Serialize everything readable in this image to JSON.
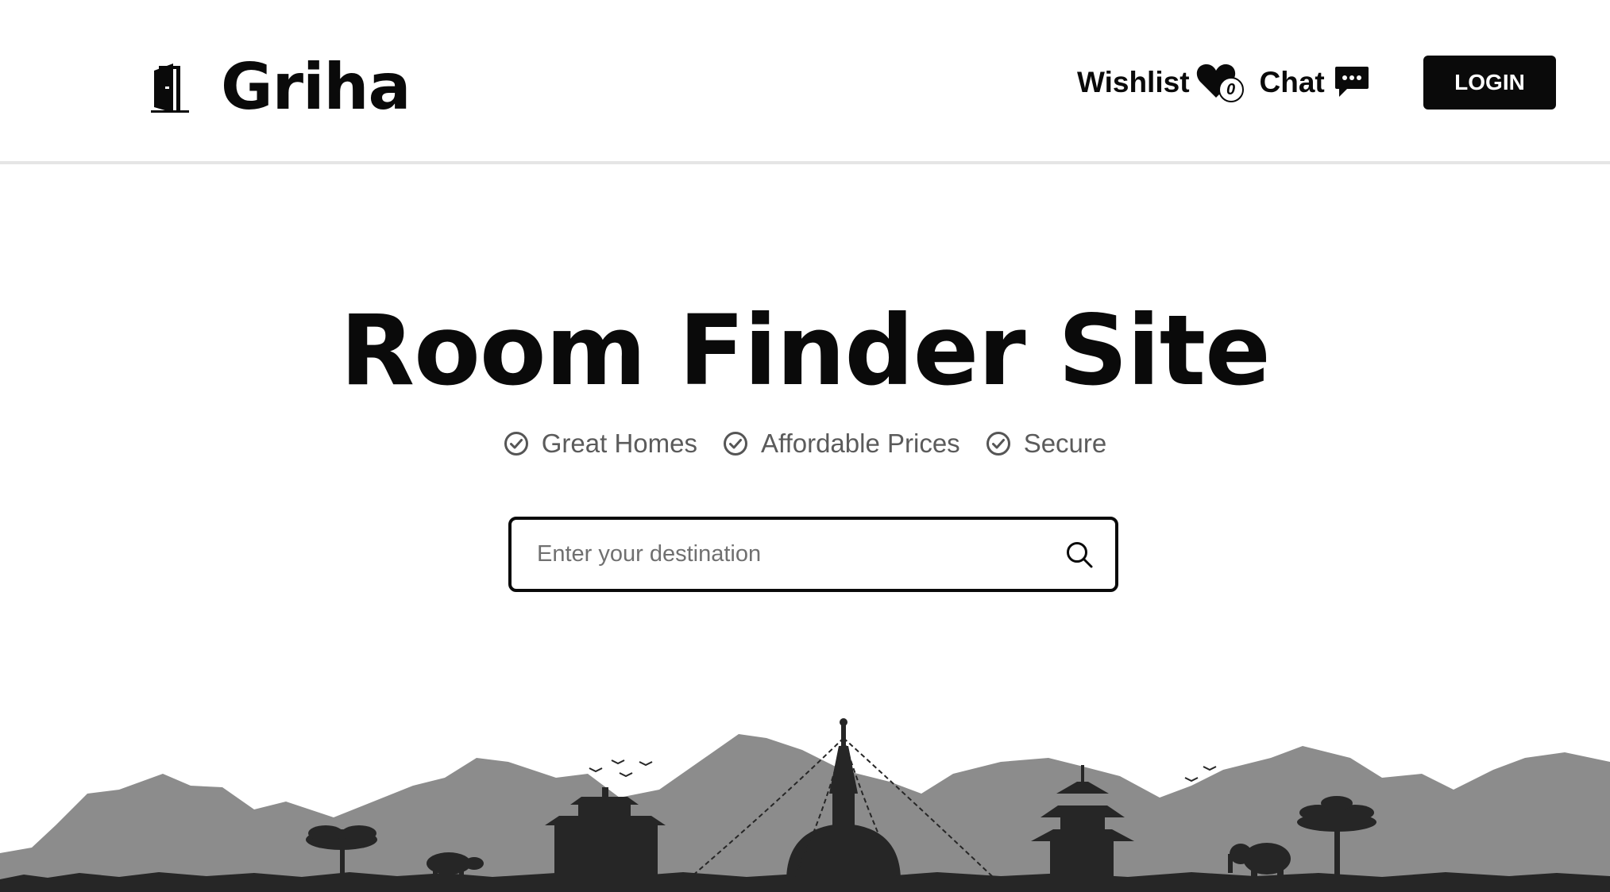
{
  "brand": {
    "name": "Griha",
    "logo_icon": "door-icon"
  },
  "nav": {
    "wishlist_label": "Wishlist",
    "wishlist_icon": "heart-icon",
    "wishlist_count": "0",
    "chat_label": "Chat",
    "chat_icon": "chat-bubble-icon",
    "login_label": "LOGIN"
  },
  "hero": {
    "title": "Room Finder Site",
    "features": [
      {
        "label": "Great Homes",
        "icon": "check-circle-icon"
      },
      {
        "label": "Affordable Prices",
        "icon": "check-circle-icon"
      },
      {
        "label": "Secure",
        "icon": "check-circle-icon"
      }
    ]
  },
  "search": {
    "placeholder": "Enter your destination",
    "value": "",
    "icon": "search-icon"
  },
  "colors": {
    "accent": "#0a0a0a",
    "muted_text": "#5b5b5b",
    "mountain": "#8c8c8c",
    "silhouette": "#262626",
    "divider": "#e5e5e5"
  }
}
